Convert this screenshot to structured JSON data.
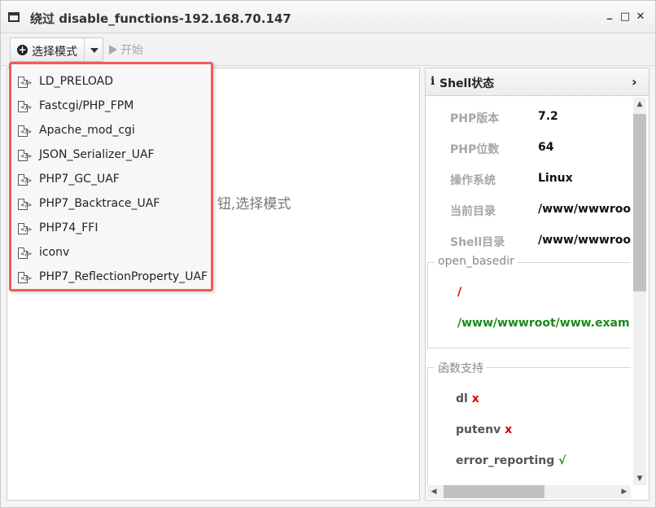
{
  "window": {
    "title": "绕过 disable_functions-192.168.70.147",
    "minimize_glyph": "_",
    "maximize_glyph": "□",
    "close_glyph": "✕"
  },
  "toolbar": {
    "mode_label": "选择模式",
    "start_label": "开始"
  },
  "main": {
    "hint": "钮,选择模式"
  },
  "dropdown": {
    "items": [
      "LD_PRELOAD",
      "Fastcgi/PHP_FPM",
      "Apache_mod_cgi",
      "JSON_Serializer_UAF",
      "PHP7_GC_UAF",
      "PHP7_Backtrace_UAF",
      "PHP74_FFI",
      "iconv",
      "PHP7_ReflectionProperty_UAF"
    ]
  },
  "shell_status": {
    "info_glyph": "i",
    "title": "Shell状态",
    "chevron": "›",
    "rows": [
      {
        "key": "PHP版本",
        "value": "7.2"
      },
      {
        "key": "PHP位数",
        "value": "64"
      },
      {
        "key": "操作系统",
        "value": "Linux"
      },
      {
        "key": "当前目录",
        "value": "/www/wwwroot"
      },
      {
        "key": "Shell目录",
        "value": "/www/wwwroot"
      }
    ],
    "open_basedir": {
      "legend": "open_basedir",
      "paths": [
        "/",
        "/www/wwwroot/www.exam"
      ]
    },
    "functions": {
      "legend": "函数支持",
      "items": [
        {
          "name": "dl",
          "mark": "x"
        },
        {
          "name": "putenv",
          "mark": "x"
        },
        {
          "name": "error_reporting",
          "mark": "√"
        }
      ]
    }
  },
  "colors": {
    "highlight_border": "#f25a5a",
    "path_root": "#e00000",
    "path_dir": "#1a8a1a",
    "unsupported": "#e00000",
    "supported": "#1a8a1a"
  }
}
